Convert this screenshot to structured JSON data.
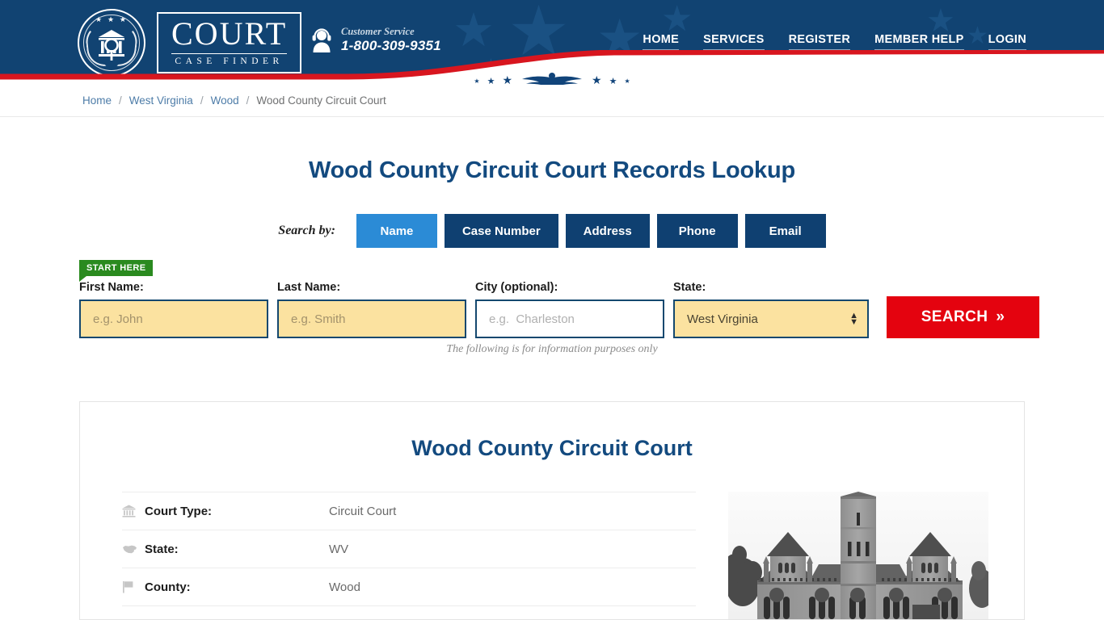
{
  "header": {
    "logo": {
      "word": "COURT",
      "subtitle": "CASE FINDER",
      "seal_stars": "★ ★ ★"
    },
    "customer_service": {
      "label": "Customer Service",
      "phone": "1-800-309-9351",
      "icon": "headset-agent-icon"
    },
    "nav": [
      {
        "label": "HOME"
      },
      {
        "label": "SERVICES"
      },
      {
        "label": "REGISTER"
      },
      {
        "label": "MEMBER HELP"
      },
      {
        "label": "LOGIN"
      }
    ],
    "colors": {
      "navy": "#114372",
      "red": "#d8161f",
      "accent_blue": "#2b8bd6"
    }
  },
  "breadcrumb": {
    "items": [
      {
        "label": "Home",
        "link": true
      },
      {
        "label": "West Virginia",
        "link": true
      },
      {
        "label": "Wood",
        "link": true
      },
      {
        "label": "Wood County Circuit Court",
        "link": false
      }
    ],
    "separator": "/"
  },
  "main": {
    "page_title": "Wood County Circuit Court Records Lookup",
    "search_by": {
      "label": "Search by:",
      "tabs": [
        {
          "label": "Name",
          "active": true
        },
        {
          "label": "Case Number",
          "active": false
        },
        {
          "label": "Address",
          "active": false
        },
        {
          "label": "Phone",
          "active": false
        },
        {
          "label": "Email",
          "active": false
        }
      ]
    },
    "start_here_badge": "START HERE",
    "form": {
      "first_name": {
        "label": "First Name:",
        "placeholder": "e.g. John",
        "value": ""
      },
      "last_name": {
        "label": "Last Name:",
        "placeholder": "e.g. Smith",
        "value": ""
      },
      "city": {
        "label": "City (optional):",
        "placeholder": "e.g.  Charleston",
        "value": ""
      },
      "state": {
        "label": "State:",
        "value": "West Virginia"
      },
      "search_button": "SEARCH",
      "search_button_chevron": "»"
    },
    "disclaimer": "The following is for information purposes only"
  },
  "court_card": {
    "title": "Wood County Circuit Court",
    "rows": [
      {
        "icon": "bank-icon",
        "key": "Court Type:",
        "value": "Circuit Court"
      },
      {
        "icon": "us-map-icon",
        "key": "State:",
        "value": "WV"
      },
      {
        "icon": "flag-icon",
        "key": "County:",
        "value": "Wood"
      }
    ],
    "photo_alt": "courthouse-photo"
  }
}
